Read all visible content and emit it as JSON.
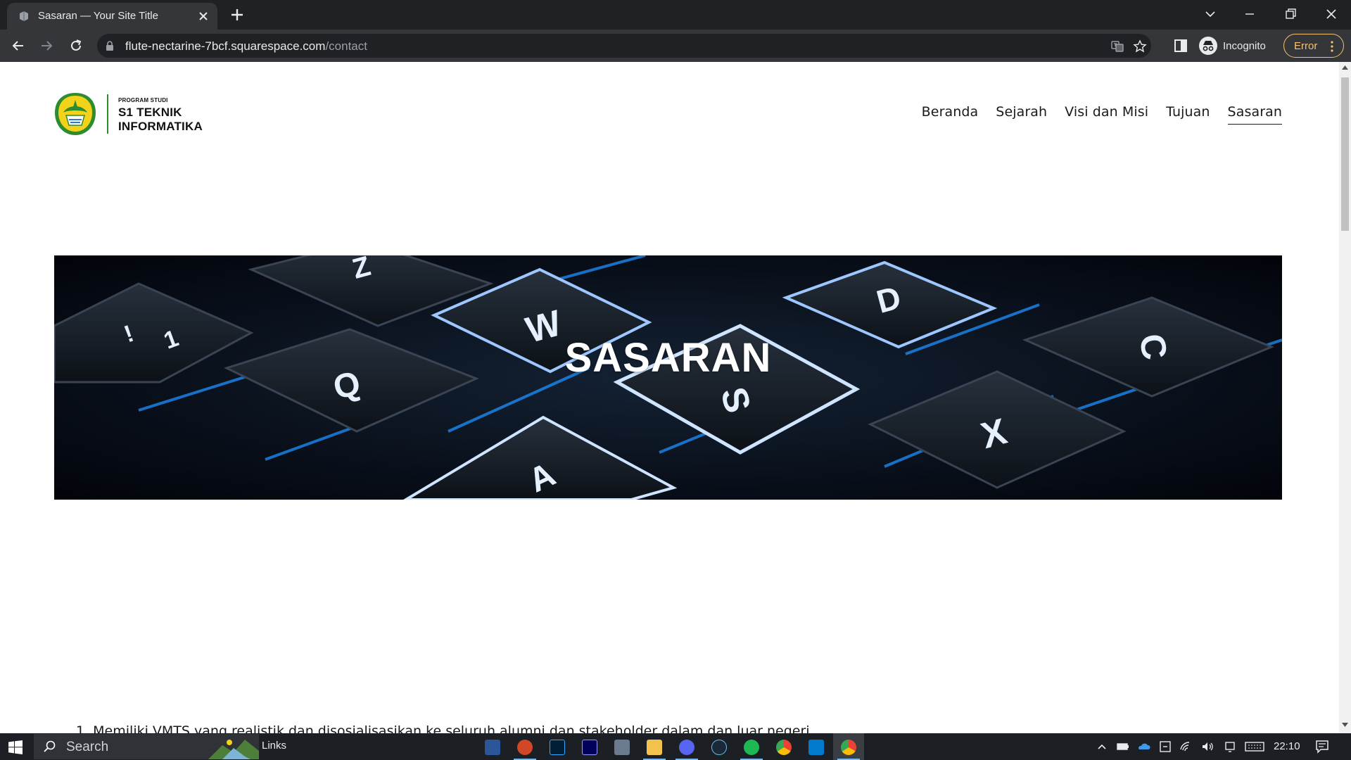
{
  "browser": {
    "tab_title": "Sasaran — Your Site Title",
    "url_host": "flute-nectarine-7bcf.squarespace.com",
    "url_path": "/contact",
    "incognito_label": "Incognito",
    "error_label": "Error"
  },
  "site": {
    "logo": {
      "line_small": "PROGRAM STUDI",
      "line1": "S1 TEKNIK",
      "line2": "INFORMATIKA"
    },
    "nav": [
      {
        "label": "Beranda",
        "active": false
      },
      {
        "label": "Sejarah",
        "active": false
      },
      {
        "label": "Visi dan Misi",
        "active": false
      },
      {
        "label": "Tujuan",
        "active": false
      },
      {
        "label": "Sasaran",
        "active": true
      }
    ],
    "hero": {
      "heading": "SASARAN",
      "keycaps": [
        "W",
        "S",
        "D",
        "Q",
        "A",
        "X",
        "C",
        "Z",
        "!",
        "1"
      ]
    },
    "list_item_1": "1. Memiliki VMTS yang realistik dan disosialisasikan ke seluruh alumni dan stakeholder dalam dan luar negeri"
  },
  "taskbar": {
    "search_text": "Search",
    "links_label": "Links",
    "apps": [
      "word-icon",
      "powerpoint-icon",
      "photoshop-icon",
      "premiere-icon",
      "photos-icon",
      "file-explorer-icon",
      "discord-icon",
      "steam-icon",
      "spotify-icon",
      "chrome-icon",
      "vscode-icon",
      "chrome-incognito-icon"
    ],
    "clock": "22:10"
  },
  "colors": {
    "chrome_dark": "#202124",
    "chrome_tab": "#35363a",
    "error_accent": "#f6c26b",
    "key_glow": "#1e90ff",
    "logo_green": "#2e8b2e"
  }
}
